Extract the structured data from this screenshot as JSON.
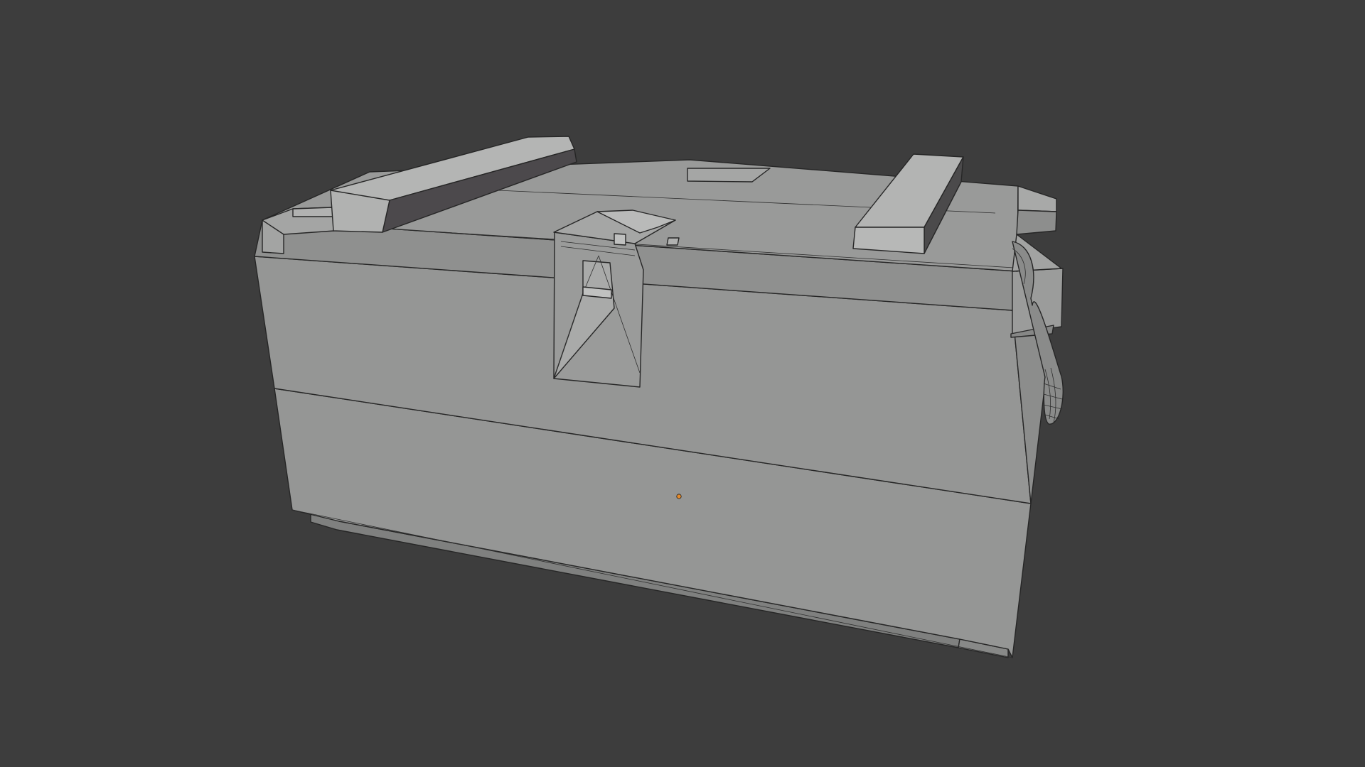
{
  "viewport": {
    "background_color": "#3d3d3d",
    "shading_mode": "solid-wireframe"
  },
  "model": {
    "object": "ammo-crate",
    "parts": [
      "crate-body",
      "lid",
      "left-handle-bar",
      "right-handle-bar",
      "front-latch",
      "side-rope-handle",
      "lid-tab",
      "base-skid"
    ],
    "surface_color": "#979897",
    "edge_color": "#2b2b2b"
  },
  "origin_marker": {
    "color": "#e58a2a"
  }
}
